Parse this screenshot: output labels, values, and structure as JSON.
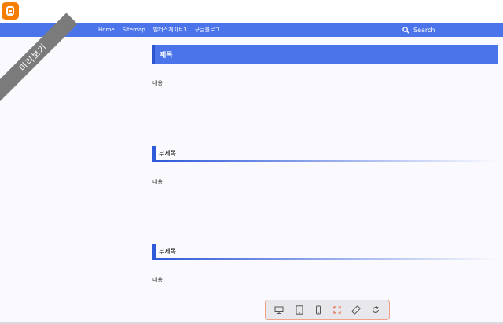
{
  "nav": {
    "links": [
      "Home",
      "Sitemap",
      "밸더스게이트3",
      "구글블로그"
    ],
    "search_label": "Search"
  },
  "ribbon": {
    "label": "미리보기"
  },
  "post": {
    "title": "제목",
    "sections": [
      {
        "heading": "",
        "body": "내용"
      },
      {
        "heading": "부제목",
        "body": "내용"
      },
      {
        "heading": "부제목",
        "body": "내용"
      }
    ]
  },
  "toolbar": {
    "tools": [
      "desktop-icon",
      "tablet-icon",
      "mobile-icon",
      "fullscreen-icon",
      "rotate-icon",
      "refresh-icon"
    ],
    "active_tool": "fullscreen-icon"
  },
  "colors": {
    "nav_bg": "#4b74ea",
    "title_bg": "#4b74ea",
    "accent": "#2f5ad9",
    "logo": "#f57d00",
    "ribbon": "#7b7b7b",
    "active_tool": "#e8582b"
  }
}
